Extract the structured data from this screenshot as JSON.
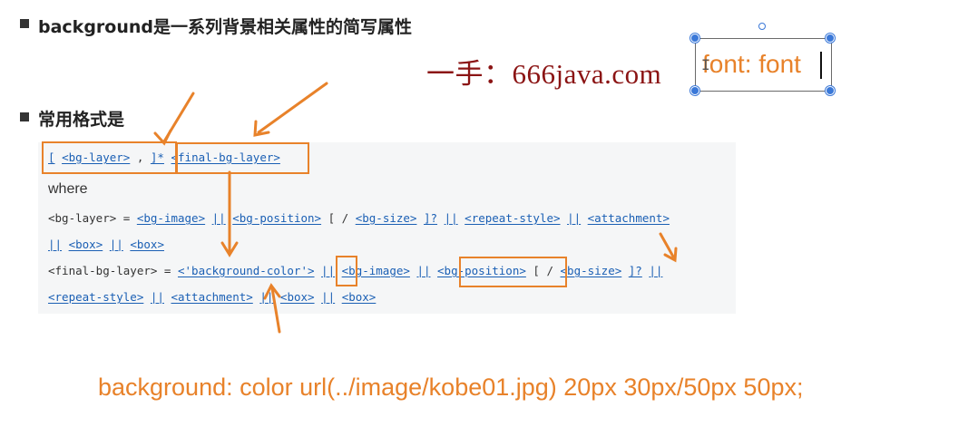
{
  "heading1": "background是一系列背景相关属性的简写属性",
  "heading2": "常用格式是",
  "watermark": "一手：666java.com",
  "textbox_text": "font: font",
  "syntax": {
    "line1": [
      {
        "t": "[",
        "l": true
      },
      {
        "t": " ",
        "l": false
      },
      {
        "t": "<bg-layer>",
        "l": true
      },
      {
        "t": " , ",
        "l": false
      },
      {
        "t": "]*",
        "l": true
      },
      {
        "t": " ",
        "l": false
      },
      {
        "t": "<final-bg-layer>",
        "l": true
      }
    ],
    "where": "where",
    "line3": [
      {
        "t": "<bg-layer> = ",
        "l": false
      },
      {
        "t": "<bg-image>",
        "l": true
      },
      {
        "t": " ",
        "l": false
      },
      {
        "t": "||",
        "l": true
      },
      {
        "t": " ",
        "l": false
      },
      {
        "t": "<bg-position>",
        "l": true
      },
      {
        "t": " [ / ",
        "l": false
      },
      {
        "t": "<bg-size>",
        "l": true
      },
      {
        "t": " ",
        "l": false
      },
      {
        "t": "]?",
        "l": true
      },
      {
        "t": " ",
        "l": false
      },
      {
        "t": "||",
        "l": true
      },
      {
        "t": " ",
        "l": false
      },
      {
        "t": "<repeat-style>",
        "l": true
      },
      {
        "t": " ",
        "l": false
      },
      {
        "t": "||",
        "l": true
      },
      {
        "t": " ",
        "l": false
      },
      {
        "t": "<attachment>",
        "l": true
      }
    ],
    "line4": [
      {
        "t": "||",
        "l": true
      },
      {
        "t": " ",
        "l": false
      },
      {
        "t": "<box>",
        "l": true
      },
      {
        "t": " ",
        "l": false
      },
      {
        "t": "||",
        "l": true
      },
      {
        "t": " ",
        "l": false
      },
      {
        "t": "<box>",
        "l": true
      }
    ],
    "line5": [
      {
        "t": "<final-bg-layer> = ",
        "l": false
      },
      {
        "t": "<'background-color'>",
        "l": true
      },
      {
        "t": " ",
        "l": false
      },
      {
        "t": "||",
        "l": true
      },
      {
        "t": " ",
        "l": false
      },
      {
        "t": "<bg-image>",
        "l": true
      },
      {
        "t": " ",
        "l": false
      },
      {
        "t": "||",
        "l": true
      },
      {
        "t": " ",
        "l": false
      },
      {
        "t": "<bg-position>",
        "l": true
      },
      {
        "t": " [ / ",
        "l": false
      },
      {
        "t": "<bg-size>",
        "l": true
      },
      {
        "t": " ",
        "l": false
      },
      {
        "t": "]?",
        "l": true
      },
      {
        "t": " ",
        "l": false
      },
      {
        "t": "||",
        "l": true
      }
    ],
    "line6": [
      {
        "t": "<repeat-style>",
        "l": true
      },
      {
        "t": " ",
        "l": false
      },
      {
        "t": "||",
        "l": true
      },
      {
        "t": " ",
        "l": false
      },
      {
        "t": "<attachment>",
        "l": true
      },
      {
        "t": " ",
        "l": false
      },
      {
        "t": "||",
        "l": true
      },
      {
        "t": " ",
        "l": false
      },
      {
        "t": "<box>",
        "l": true
      },
      {
        "t": " ",
        "l": false
      },
      {
        "t": "||",
        "l": true
      },
      {
        "t": " ",
        "l": false
      },
      {
        "t": "<box>",
        "l": true
      }
    ]
  },
  "bottom_code": "background: color url(../image/kobe01.jpg) 20px 30px/50px 50px;",
  "colors": {
    "annotation_orange": "#e8822a",
    "link_blue": "#1a5fb4",
    "watermark_red": "#8b1414",
    "handle_blue": "#3a78d8"
  }
}
